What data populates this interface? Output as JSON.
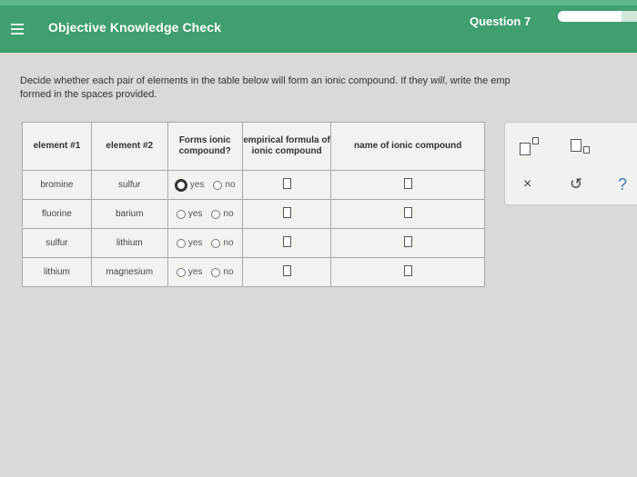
{
  "header": {
    "app_title": "Objective Knowledge Check",
    "question_label": "Question 7",
    "progress": 0.8
  },
  "instructions": {
    "line1_pre": "Decide whether each pair of elements in the table below will form an ionic compound. If they ",
    "line1_em": "will",
    "line1_post": ", write the emp",
    "line2": "formed in the spaces provided."
  },
  "table": {
    "headers": [
      "element #1",
      "element #2",
      "Forms ionic compound?",
      "empirical formula of ionic compound",
      "name of ionic compound"
    ],
    "yes_label": "yes",
    "no_label": "no",
    "rows": [
      {
        "el1": "bromine",
        "el2": "sulfur",
        "forms": "yes"
      },
      {
        "el1": "fluorine",
        "el2": "barium",
        "forms": ""
      },
      {
        "el1": "sulfur",
        "el2": "lithium",
        "forms": ""
      },
      {
        "el1": "lithium",
        "el2": "magnesium",
        "forms": ""
      }
    ]
  },
  "tools": {
    "superscript_icon": "superscript-icon",
    "subscript_icon": "subscript-icon",
    "clear_label": "×",
    "undo_label": "↺",
    "help_label": "?"
  }
}
